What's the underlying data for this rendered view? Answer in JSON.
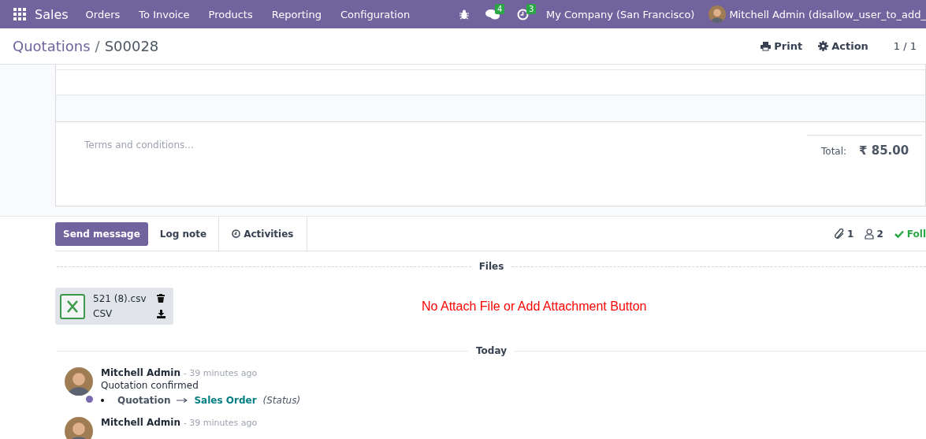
{
  "navbar": {
    "app": "Sales",
    "menu": [
      "Orders",
      "To Invoice",
      "Products",
      "Reporting",
      "Configuration"
    ],
    "messages_count": "4",
    "activities_count": "3",
    "company": "My Company (San Francisco)",
    "user": "Mitchell Admin (disallow_user_to_add_"
  },
  "control_panel": {
    "breadcrumb": [
      "Quotations",
      "S00028"
    ],
    "breadcrumb_separator": "/",
    "actions": [
      "Print",
      "Action"
    ],
    "pager": "1 / 1"
  },
  "form": {
    "terms_placeholder": "Terms and conditions...",
    "total_label": "Total:",
    "total": "₹ 85.00"
  },
  "chatter": {
    "buttons": [
      {
        "label": "Send message",
        "kind": "primary"
      },
      {
        "label": "Log note",
        "kind": "plain"
      },
      {
        "label": "Activities",
        "kind": "boxed"
      }
    ],
    "attachments_count": "1",
    "followers_count": "2",
    "follow_label": "Foll",
    "files_title": "Files",
    "attachments": [
      {
        "name": "521 (8).csv",
        "type": "CSV"
      }
    ],
    "note": "No Attach File or Add Attachment Button",
    "today_label": "Today",
    "messages": [
      {
        "author": "Mitchell Admin",
        "time": "- 39 minutes ago",
        "body": "Quotation confirmed",
        "changes": [
          {
            "old": "Quotation",
            "new": "Sales Order",
            "field": "(Status)"
          }
        ]
      },
      {
        "author": "Mitchell Admin",
        "time": "- 39 minutes ago"
      }
    ]
  }
}
